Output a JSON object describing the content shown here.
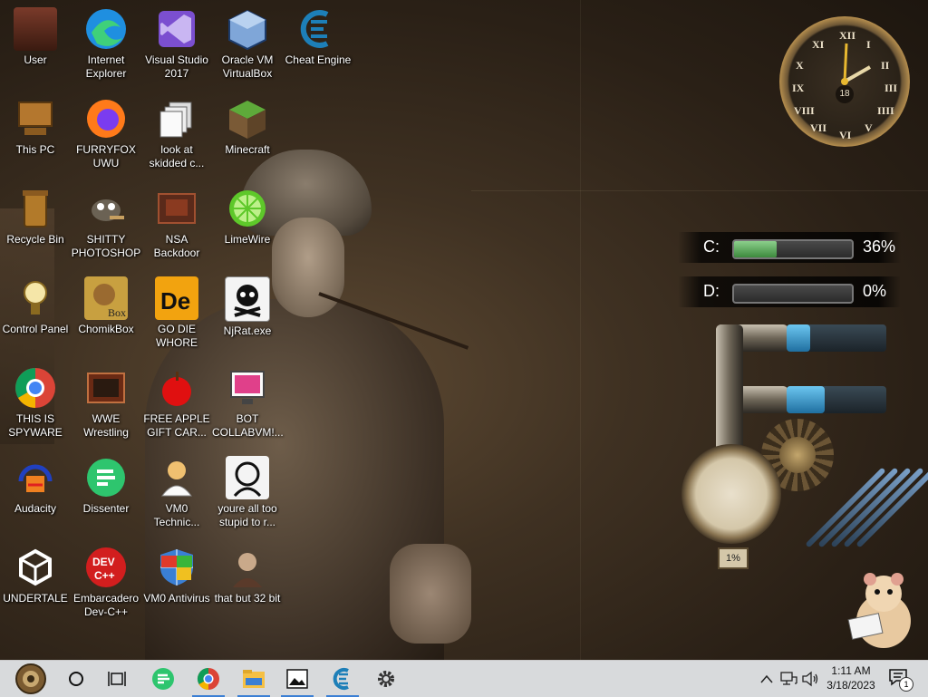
{
  "desktop": {
    "icons": [
      {
        "label": "User",
        "icon": "user-folder-icon"
      },
      {
        "label": "Internet Explorer",
        "icon": "edge-icon"
      },
      {
        "label": "Visual Studio 2017",
        "icon": "visual-studio-icon"
      },
      {
        "label": "Oracle VM VirtualBox",
        "icon": "virtualbox-icon"
      },
      {
        "label": "Cheat Engine",
        "icon": "cheat-engine-icon"
      },
      {
        "label": "This PC",
        "icon": "computer-icon"
      },
      {
        "label": "FURRYFOX UWU",
        "icon": "firefox-icon"
      },
      {
        "label": "look at skidded c...",
        "icon": "shortcut-icon"
      },
      {
        "label": "Minecraft",
        "icon": "minecraft-icon"
      },
      {
        "label": "Recycle Bin",
        "icon": "recycle-bin-icon"
      },
      {
        "label": "SHITTY PHOTOSHOP",
        "icon": "gimp-icon"
      },
      {
        "label": "NSA Backdoor",
        "icon": "folder-icon"
      },
      {
        "label": "LimeWire",
        "icon": "limewire-icon"
      },
      {
        "label": "Control Panel",
        "icon": "control-panel-icon"
      },
      {
        "label": "ChomikBox",
        "icon": "chomikbox-icon"
      },
      {
        "label": "GO DIE WHORE",
        "icon": "de-icon"
      },
      {
        "label": "NjRat.exe",
        "icon": "skull-icon"
      },
      {
        "label": "THIS IS SPYWARE",
        "icon": "chrome-icon"
      },
      {
        "label": "WWE Wrestling",
        "icon": "tv-icon"
      },
      {
        "label": "FREE APPLE GIFT CAR...",
        "icon": "apple-icon"
      },
      {
        "label": "BOT COLLABVM!...",
        "icon": "monitor-icon"
      },
      {
        "label": "Audacity",
        "icon": "audacity-icon"
      },
      {
        "label": "Dissenter",
        "icon": "dissenter-icon"
      },
      {
        "label": "VM0 Technic...",
        "icon": "technician-icon"
      },
      {
        "label": "youre all too stupid to r...",
        "icon": "portrait-icon"
      },
      {
        "label": "UNDERTALE",
        "icon": "unity-icon"
      },
      {
        "label": "Embarcadero Dev-C++",
        "icon": "devcpp-icon"
      },
      {
        "label": "VM0 Antivirus",
        "icon": "shield-icon"
      },
      {
        "label": "that but 32 bit",
        "icon": "portrait-icon"
      }
    ]
  },
  "gadgets": {
    "clock": {
      "numerals": [
        "XII",
        "I",
        "II",
        "III",
        "IIII",
        "V",
        "VI",
        "VII",
        "VIII",
        "IX",
        "X",
        "XI"
      ],
      "date": "18"
    },
    "drives": [
      {
        "letter": "C:",
        "percent_text": "36%",
        "used_fraction": 0.36
      },
      {
        "letter": "D:",
        "percent_text": "0%",
        "used_fraction": 0.0
      }
    ],
    "cpu_tubes": [
      0.2,
      0.2
    ],
    "gauge_readout": "1%"
  },
  "taskbar": {
    "start": "start-orb-icon",
    "items": [
      {
        "name": "cortana-search",
        "icon": "circle-icon",
        "active": false
      },
      {
        "name": "task-view",
        "icon": "task-view-icon",
        "active": false
      },
      {
        "name": "dissenter",
        "icon": "dissenter-icon",
        "active": false
      },
      {
        "name": "chrome",
        "icon": "chrome-icon",
        "active": true
      },
      {
        "name": "file-explorer",
        "icon": "folder-icon",
        "active": true
      },
      {
        "name": "photos",
        "icon": "image-icon",
        "active": true
      },
      {
        "name": "cheat-engine",
        "icon": "cheat-engine-icon",
        "active": true
      },
      {
        "name": "settings",
        "icon": "gear-icon",
        "active": false
      }
    ],
    "time": "1:11 AM",
    "date": "3/18/2023",
    "notification_count": "1"
  },
  "colors": {
    "taskbar_bg": "#d8dadc",
    "active_indicator": "#3b7fd4",
    "drive_fill": "#3d8a3d",
    "tube_fill": "#1f6fa0"
  }
}
